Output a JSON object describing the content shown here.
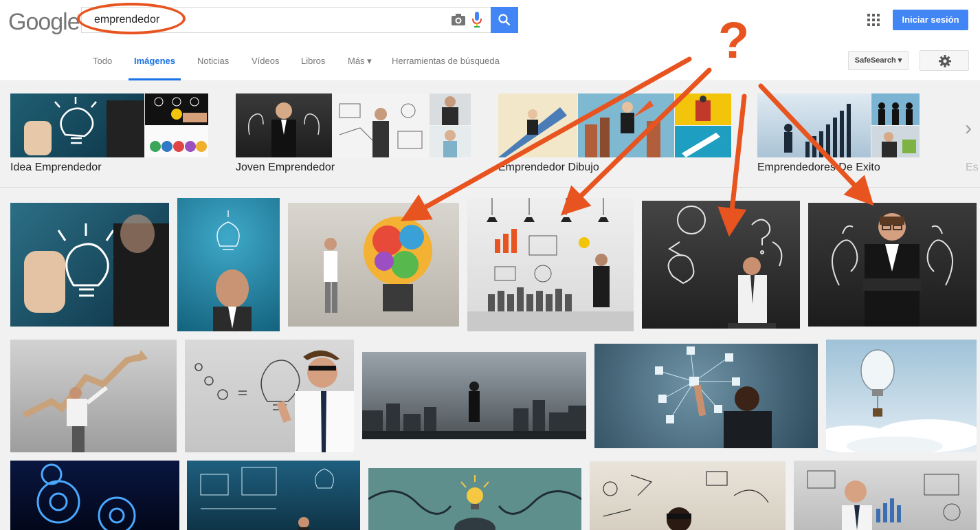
{
  "header": {
    "logo_text": "Google",
    "search_value": "emprendedor",
    "signin_label": "Iniciar sesión",
    "camera_icon": "camera-icon",
    "mic_icon": "microphone-icon",
    "search_icon": "search-icon",
    "apps_icon": "apps-grid-icon"
  },
  "nav": {
    "tabs": [
      {
        "label": "Todo"
      },
      {
        "label": "Imágenes"
      },
      {
        "label": "Noticias"
      },
      {
        "label": "Vídeos"
      },
      {
        "label": "Libros"
      },
      {
        "label": "Más ▾"
      },
      {
        "label": "Herramientas de búsqueda"
      }
    ],
    "active_tab": "Imágenes",
    "safesearch_label": "SafeSearch ▾",
    "settings_icon": "gear-icon"
  },
  "related": [
    {
      "label": "Idea Emprendedor"
    },
    {
      "label": "Joven Emprendedor"
    },
    {
      "label": "Emprendedor Dibujo"
    },
    {
      "label": "Emprendedores De Exito"
    },
    {
      "label": "Es"
    }
  ],
  "annotation": {
    "question_mark": "?",
    "color": "#e8541f"
  },
  "colors": {
    "accent": "#4285f4",
    "annotation": "#e8541f",
    "active_tab": "#1a73e8"
  }
}
